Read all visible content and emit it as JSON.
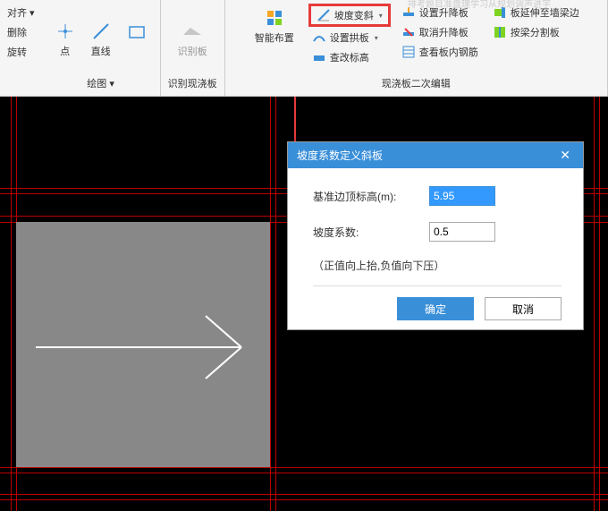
{
  "left_partial": {
    "l1": "对齐 ▾",
    "l2": "删除",
    "l3": "旋转"
  },
  "ribbon": {
    "group1": {
      "title": "绘图 ▾",
      "point": "点",
      "line": "直线"
    },
    "group2": {
      "title": "识别现浇板",
      "recognize": "识别板"
    },
    "group3": {
      "title": "现浇板二次编辑",
      "smart_layout": "智能布置",
      "slope_incline": "坡度变斜",
      "set_arch": "设置拱板",
      "modify_elev": "查改标高",
      "set_lift": "设置升降板",
      "cancel_lift": "取消升降板",
      "view_rebar": "查看板内钢筋",
      "extend_wall": "板延伸至墙梁边",
      "beam_split": "按梁分割板"
    }
  },
  "dialog": {
    "title": "坡度系数定义斜板",
    "label_elev": "基准边顶标高(m):",
    "value_elev": "5.95",
    "label_slope": "坡度系数:",
    "value_slope": "0.5",
    "hint": "（正值向上抬,负值向下压）",
    "ok": "确定",
    "cancel": "取消"
  },
  "hint_top": "排考题目准盘理学习从规划调声进字"
}
